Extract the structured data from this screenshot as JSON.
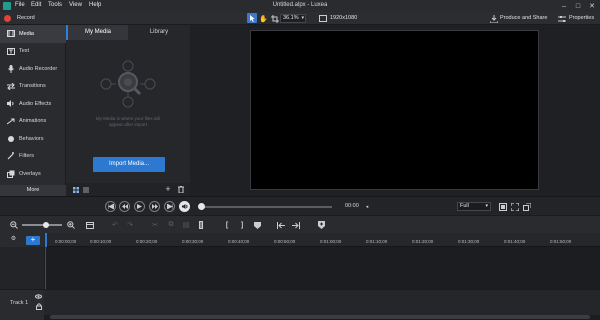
{
  "app": {
    "title": "Untitled.alpx - Luxea",
    "menu": [
      "File",
      "Edit",
      "Tools",
      "View",
      "Help"
    ]
  },
  "toolbar": {
    "record_label": "Record",
    "zoom_value": "36.1%",
    "resolution": "1920x1080",
    "produce_label": "Produce and Share",
    "properties_label": "Properties"
  },
  "nav": {
    "items": [
      "Media",
      "Text",
      "Audio Recorder",
      "Transitions",
      "Audio Effects",
      "Animations",
      "Behaviors",
      "Filters",
      "Overlays"
    ],
    "more_label": "More"
  },
  "media": {
    "tabs": [
      "My Media",
      "Library"
    ],
    "hint": "My Media is where your files will appear after import",
    "import_label": "Import Media..."
  },
  "playback": {
    "time": "00:00",
    "quality": "Full"
  },
  "timeline": {
    "ticks": [
      "0:00:00;00",
      "0:00:10;00",
      "0:00:20;00",
      "0:00:30;00",
      "0:00:40;00",
      "0:00:50;00",
      "0:01:00;00",
      "0:01:10;00",
      "0:01:20;00",
      "0:01:30;00",
      "0:01:40;00",
      "0:01:50;00"
    ],
    "track_name": "Track 1"
  },
  "colors": {
    "accent": "#2d78d0",
    "record": "#e0433a"
  }
}
